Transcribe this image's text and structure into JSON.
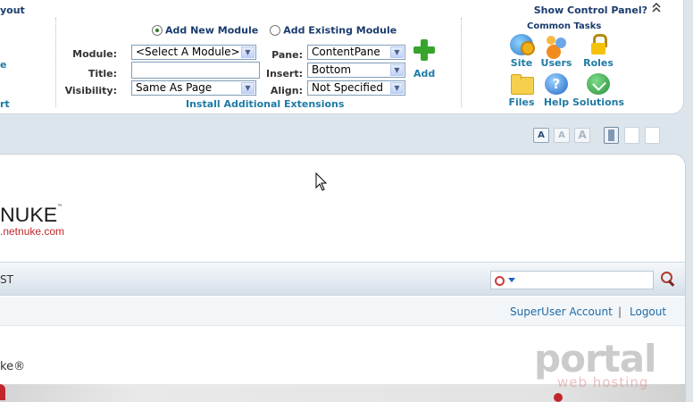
{
  "control_panel": {
    "left_fragment_top": "yout",
    "left_fragments": [
      "e",
      "rt"
    ],
    "show_control_panel": "Show Control Panel?",
    "module_mode": {
      "add_new": "Add New Module",
      "add_existing": "Add Existing Module",
      "selected": "add_new"
    },
    "fields": {
      "module_label": "Module:",
      "module_value": "<Select A Module>",
      "title_label": "Title:",
      "title_value": "",
      "visibility_label": "Visibility:",
      "visibility_value": "Same As Page",
      "pane_label": "Pane:",
      "pane_value": "ContentPane",
      "insert_label": "Insert:",
      "insert_value": "Bottom",
      "align_label": "Align:",
      "align_value": "Not Specified"
    },
    "add_label": "Add",
    "install_link": "Install Additional Extensions",
    "common_tasks": {
      "title": "Common Tasks",
      "items": [
        {
          "label": "Site",
          "icon": "site-settings-icon"
        },
        {
          "label": "Users",
          "icon": "users-icon"
        },
        {
          "label": "Roles",
          "icon": "roles-lock-icon"
        },
        {
          "label": "Files",
          "icon": "files-folder-icon"
        },
        {
          "label": "Help",
          "icon": "help-icon"
        },
        {
          "label": "Solutions",
          "icon": "solutions-icon"
        }
      ]
    }
  },
  "toolbar": {
    "font_buttons": [
      "A",
      "A",
      "A"
    ]
  },
  "site": {
    "logo_text": "NUKE",
    "logo_tm": "™",
    "logo_url_fragment": ".netnuke.com",
    "nav_fragment": "ST",
    "user_links": {
      "account": "SuperUser Account",
      "separator": "|",
      "logout": "Logout"
    },
    "body_fragment": "ke®"
  },
  "watermark": {
    "main": "portal",
    "sub": "web hosting"
  },
  "colors": {
    "link": "#1f7aa5",
    "heading": "#1a3c6e",
    "brand_red": "#c0272d",
    "background": "#dde5ec"
  }
}
